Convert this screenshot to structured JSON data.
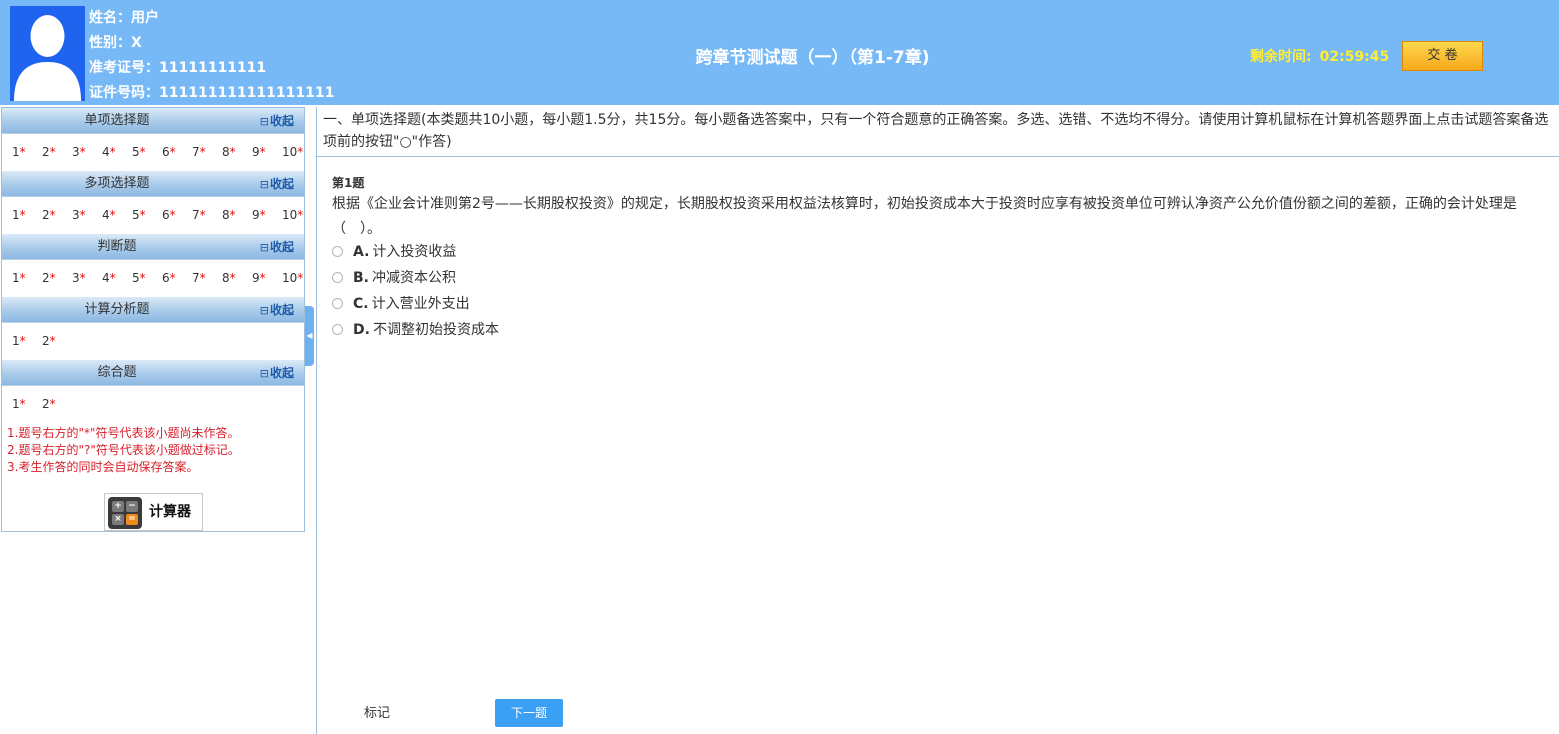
{
  "candidate": {
    "name_label": "姓名：",
    "name": "用户",
    "gender_label": "性别：",
    "gender": "X",
    "exam_no_label": "准考证号：",
    "exam_no": "11111111111",
    "id_label": "证件号码：",
    "id_no": "111111111111111111"
  },
  "header": {
    "title": "跨章节测试题（一）（第1-7章)",
    "timer_label": "剩余时间:",
    "timer_value": "02:59:45",
    "submit_label": "交 卷"
  },
  "sidebar": {
    "collapse_label": "收起",
    "collapse_box": "⊟",
    "sections": [
      {
        "title": "单项选择题",
        "items": [
          "1",
          "2",
          "3",
          "4",
          "5",
          "6",
          "7",
          "8",
          "9",
          "10"
        ]
      },
      {
        "title": "多项选择题",
        "items": [
          "1",
          "2",
          "3",
          "4",
          "5",
          "6",
          "7",
          "8",
          "9",
          "10"
        ]
      },
      {
        "title": "判断题",
        "items": [
          "1",
          "2",
          "3",
          "4",
          "5",
          "6",
          "7",
          "8",
          "9",
          "10"
        ]
      },
      {
        "title": "计算分析题",
        "items": [
          "1",
          "2"
        ]
      },
      {
        "title": "综合题",
        "items": [
          "1",
          "2"
        ]
      }
    ],
    "unanswered_mark": "*",
    "notes": [
      "1.题号右方的\"*\"符号代表该小题尚未作答。",
      "2.题号右方的\"?\"符号代表该小题做过标记。",
      "3.考生作答的同时会自动保存答案。"
    ],
    "calculator_label": "计算器",
    "calculator_keys": [
      "+",
      "−",
      "×",
      "="
    ]
  },
  "main": {
    "instructions": "一、单项选择题(本类题共10小题，每小题1.5分，共15分。每小题备选答案中，只有一个符合题意的正确答案。多选、选错、不选均不得分。请使用计算机鼠标在计算机答题界面上点击试题答案备选项前的按钮\"○\"作答)",
    "question_number": "第1题",
    "question_text": "根据《企业会计准则第2号——长期股权投资》的规定，长期股权投资采用权益法核算时，初始投资成本大于投资时应享有被投资单位可辨认净资产公允价值份额之间的差额，正确的会计处理是（　）。",
    "options": [
      {
        "letter": "A.",
        "text": "计入投资收益"
      },
      {
        "letter": "B.",
        "text": "冲减资本公积"
      },
      {
        "letter": "C.",
        "text": "计入营业外支出"
      },
      {
        "letter": "D.",
        "text": "不调整初始投资成本"
      }
    ],
    "mark_label": "标记",
    "next_label": "下一题"
  },
  "colors": {
    "header_bg": "#77b9f7",
    "timer": "#ffee33",
    "submit_bg": "#f7b92a",
    "note_red": "#d8202a",
    "next_btn": "#3aa0f4",
    "avatar_bg": "#1f64ee"
  }
}
